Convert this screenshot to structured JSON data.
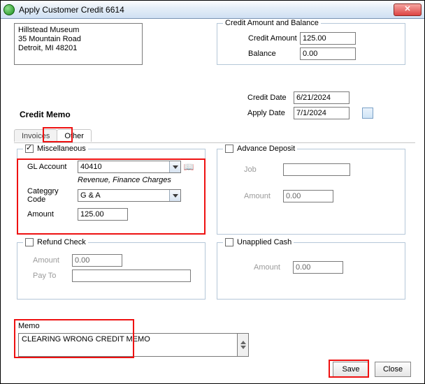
{
  "window": {
    "title": "Apply Customer Credit 6614"
  },
  "address": {
    "line1": "Hillstead Museum",
    "line2": "35 Mountain Road",
    "line3": "Detroit, MI  48201"
  },
  "cab": {
    "legend": "Credit Amount and Balance",
    "credit_amount_label": "Credit Amount",
    "credit_amount_value": "125.00",
    "balance_label": "Balance",
    "balance_value": "0.00"
  },
  "dates": {
    "credit_date_label": "Credit Date",
    "credit_date_value": "6/21/2024",
    "apply_date_label": "Apply Date",
    "apply_date_value": "7/1/2024"
  },
  "heading": "Credit Memo",
  "tabs": {
    "invoices": "Invoices",
    "other": "Other"
  },
  "misc": {
    "legend": "Miscellaneous",
    "gl_label": "GL Account",
    "gl_value": "40410",
    "gl_desc": "Revenue, Finance Charges",
    "cat_label": "Categgry Code",
    "cat_value": "G & A",
    "amount_label": "Amount",
    "amount_value": "125.00"
  },
  "adv": {
    "legend": "Advance Deposit",
    "job_label": "Job",
    "job_value": "",
    "amount_label": "Amount",
    "amount_value": "0.00"
  },
  "ref": {
    "legend": "Refund Check",
    "amount_label": "Amount",
    "amount_value": "0.00",
    "payto_label": "Pay To",
    "payto_value": ""
  },
  "unc": {
    "legend": "Unapplied Cash",
    "amount_label": "Amount",
    "amount_value": "0.00"
  },
  "memo": {
    "label": "Memo",
    "value": "CLEARING WRONG CREDIT MEMO"
  },
  "buttons": {
    "save": "Save",
    "close": "Close"
  }
}
